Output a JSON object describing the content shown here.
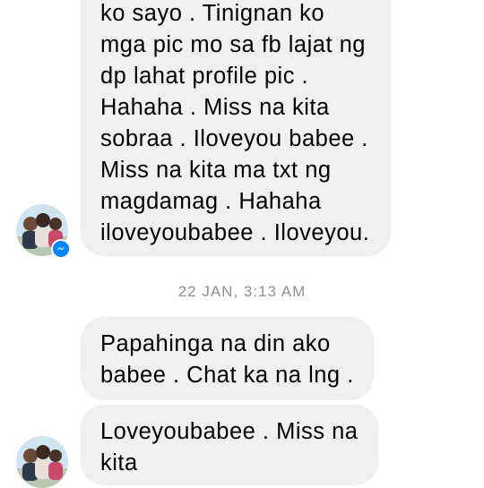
{
  "thread": {
    "messages": [
      {
        "lines": [
          "ko sayo . Tinignan ko",
          "mga pic mo sa fb lajat ng",
          "dp lahat profile pic .",
          "Hahaha . Miss na kita",
          "sobraa . Iloveyou babee .",
          "Miss na kita ma txt ng",
          "magdamag . Hahaha",
          "iloveyoubabee . Iloveyou."
        ]
      },
      {
        "lines": [
          "Papahinga na din ako",
          "babee . Chat ka na lng ."
        ]
      },
      {
        "lines": [
          "Loveyoubabee . Miss na",
          "kita"
        ]
      }
    ],
    "timestamp": "22 JAN, 3:13 AM"
  },
  "colors": {
    "bubble_bg": "#f0f0f0",
    "timestamp_text": "#8e9097",
    "messenger_badge": "#0084ff"
  },
  "icons": {
    "avatar": "contact-photo",
    "badge": "messenger-icon"
  }
}
